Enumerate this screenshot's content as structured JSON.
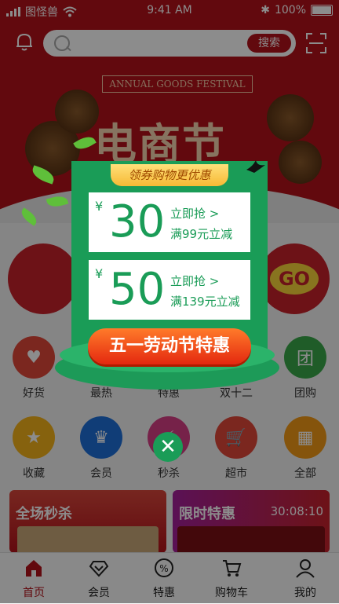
{
  "status_bar": {
    "carrier": "图怪兽",
    "time": "9:41 AM",
    "battery": "100%"
  },
  "search": {
    "placeholder": "",
    "button_label": "搜索"
  },
  "banner": {
    "ribbon": "ANNUAL GOODS FESTIVAL",
    "headline": "电商节"
  },
  "categories_row1": [
    {
      "label": "好货",
      "color": "#e0473a"
    },
    {
      "label": "最热",
      "color": "#f39a17"
    },
    {
      "label": "特惠",
      "color": "#e84a7f"
    },
    {
      "label": "双十二",
      "color": "#e0473a"
    },
    {
      "label": "团购",
      "color": "#3aa84a"
    }
  ],
  "categories_row2": [
    {
      "label": "收藏",
      "color": "#f5b21b"
    },
    {
      "label": "会员",
      "color": "#1e6fd9"
    },
    {
      "label": "秒杀",
      "color": "#d83f86"
    },
    {
      "label": "超市",
      "color": "#e0473a"
    },
    {
      "label": "全部",
      "color": "#f39a17"
    }
  ],
  "promo_cards": {
    "left_title": "全场秒杀",
    "right_title": "限时特惠",
    "countdown": "30:08:10"
  },
  "popup": {
    "header": "领券购物更优惠",
    "coupons": [
      {
        "currency": "¥",
        "amount": "30",
        "action": "立即抢 >",
        "condition": "满99元立减"
      },
      {
        "currency": "¥",
        "amount": "50",
        "action": "立即抢 >",
        "condition": "满139元立减"
      }
    ],
    "cta": "五一劳动节特惠"
  },
  "nav": [
    {
      "label": "首页",
      "active": true
    },
    {
      "label": "会员",
      "active": false
    },
    {
      "label": "特惠",
      "active": false
    },
    {
      "label": "购物车",
      "active": false
    },
    {
      "label": "我的",
      "active": false
    }
  ],
  "colors": {
    "brand": "#b3121a",
    "popup_green": "#1a9c57",
    "cta_orange": "#e4280f"
  }
}
